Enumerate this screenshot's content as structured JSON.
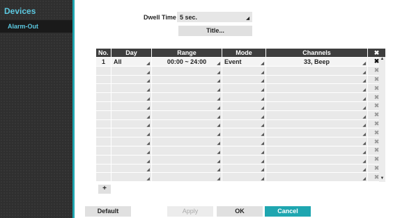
{
  "sidebar": {
    "title": "Devices",
    "items": [
      {
        "label": "Alarm-Out"
      }
    ]
  },
  "settings": {
    "dwell_label": "Dwell Time",
    "dwell_value": "5 sec.",
    "title_button": "Title..."
  },
  "table": {
    "headers": [
      "No.",
      "Day",
      "Range",
      "Mode",
      "Channels",
      "✖"
    ],
    "first_row": {
      "no": "1",
      "day": "All",
      "range": "00:00 ~ 24:00",
      "mode": "Event",
      "channels": "33, Beep"
    },
    "empty_rows": 13
  },
  "add_label": "+",
  "buttons": {
    "default": "Default",
    "apply": "Apply",
    "ok": "OK",
    "cancel": "Cancel"
  },
  "colors": {
    "accent": "#1fa6b0",
    "sidebar_text": "#5cc8e0",
    "header": "#3e3e3e"
  }
}
